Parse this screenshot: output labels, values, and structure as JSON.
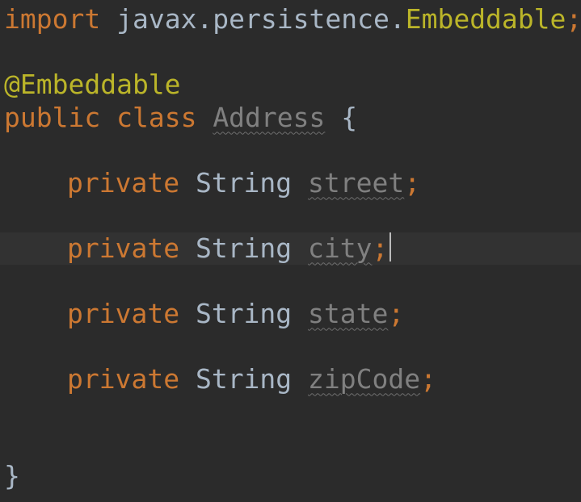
{
  "code": {
    "import_keyword": "import",
    "import_package": "javax.persistence.",
    "import_class": "Embeddable",
    "import_semicolon": ";",
    "annotation": "@Embeddable",
    "class_modifier": "public",
    "class_keyword": "class",
    "class_name": "Address",
    "open_brace": "{",
    "close_brace": "}",
    "fields": [
      {
        "modifier": "private",
        "type": "String",
        "name": "street",
        "semicolon": ";"
      },
      {
        "modifier": "private",
        "type": "String",
        "name": "city",
        "semicolon": ";"
      },
      {
        "modifier": "private",
        "type": "String",
        "name": "state",
        "semicolon": ";"
      },
      {
        "modifier": "private",
        "type": "String",
        "name": "zipCode",
        "semicolon": ";"
      }
    ]
  },
  "colors": {
    "background": "#2b2b2b",
    "current_line": "#323232",
    "keyword": "#cc7832",
    "annotation": "#bbb529",
    "default_text": "#a9b7c6",
    "unused_identifier": "#808080"
  }
}
